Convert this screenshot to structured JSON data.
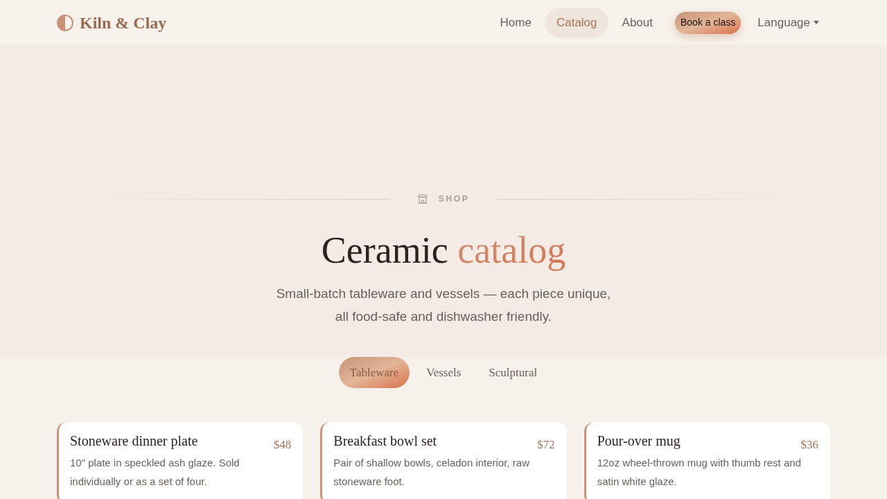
{
  "nav": {
    "brand": "Kiln & Clay",
    "links": [
      {
        "label": "Home",
        "selected": false
      },
      {
        "label": "Catalog",
        "selected": true
      },
      {
        "label": "About",
        "selected": false
      }
    ],
    "cta": "Book a class",
    "language": "Language"
  },
  "hero": {
    "eyebrow": "SHOP",
    "title": "Ceramic",
    "title_accent": "catalog",
    "subtitle": "Small-batch tableware and vessels — each piece unique, all food-safe and dishwasher friendly."
  },
  "tabs": [
    {
      "label": "Tableware",
      "selected": true
    },
    {
      "label": "Vessels",
      "selected": false
    },
    {
      "label": "Sculptural",
      "selected": false
    }
  ],
  "products": [
    {
      "name": "Stoneware dinner plate",
      "price": "$48",
      "description": "10\" plate in speckled ash glaze. Sold individually or as a set of four."
    },
    {
      "name": "Breakfast bowl set",
      "price": "$72",
      "description": "Pair of shallow bowls, celadon interior, raw stoneware foot."
    },
    {
      "name": "Pour-over mug",
      "price": "$36",
      "description": "12oz wheel-thrown mug with thumb rest and satin white glaze."
    }
  ]
}
